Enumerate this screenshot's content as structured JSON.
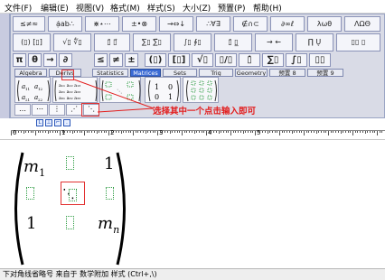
{
  "menu": [
    "文件(F)",
    "编辑(E)",
    "视图(V)",
    "格式(M)",
    "样式(S)",
    "大小(Z)",
    "预置(P)",
    "帮助(H)"
  ],
  "toolbar": {
    "row1": [
      "≤≠≈",
      "ạ̇ab∴",
      "⋇⋆⋯",
      "±•⊗",
      "→⇔↓",
      "∴∀∃",
      "∉∩⊂",
      "∂∞ℓ",
      "λωθ",
      "ΛΩΘ"
    ],
    "row2": [
      "(▯) [▯]",
      "√▯ ∜▯",
      "▯̄ ▯⃗",
      "∑▯ ∑̈▯",
      "∫▯ ∮▯",
      "▯̄ ▯̲",
      "→ ←",
      "∏̇ Ų",
      "▯▯ ▯"
    ],
    "row3": [
      "π",
      "θ",
      "→",
      "∂",
      "≤",
      "≠",
      "±",
      "(▯)",
      "[▯]",
      "√▯",
      "▯/▯",
      "▯̇",
      "∑▯",
      "∫▯",
      "▯▯"
    ],
    "tabs": [
      "Algebra",
      "Derivs",
      "Statistics",
      "Matrices",
      "Sets",
      "Trig",
      "Geometry",
      "预置 8",
      "预置 9"
    ],
    "active_tab": "Matrices",
    "small_buttons": [
      "…",
      "⋯",
      "⋮",
      "⋰",
      "⋱"
    ]
  },
  "annotation": "选择其中一个点击输入即可",
  "ruler": {
    "numbers": [
      "0",
      "1",
      "2",
      "3",
      "4",
      "5"
    ]
  },
  "equation": {
    "m1_base": "m",
    "m1_sub": "1",
    "top_right": "1",
    "bottom_left": "1",
    "mn_base": "m",
    "mn_sub": "n"
  },
  "status_text": "下对角线省略号 来自于 数学附加 样式 (Ctrl+,\\)",
  "colors": {
    "accent": "#3a6ad4",
    "annotation": "#e21d1d",
    "placeholder": "#2d9b42"
  }
}
